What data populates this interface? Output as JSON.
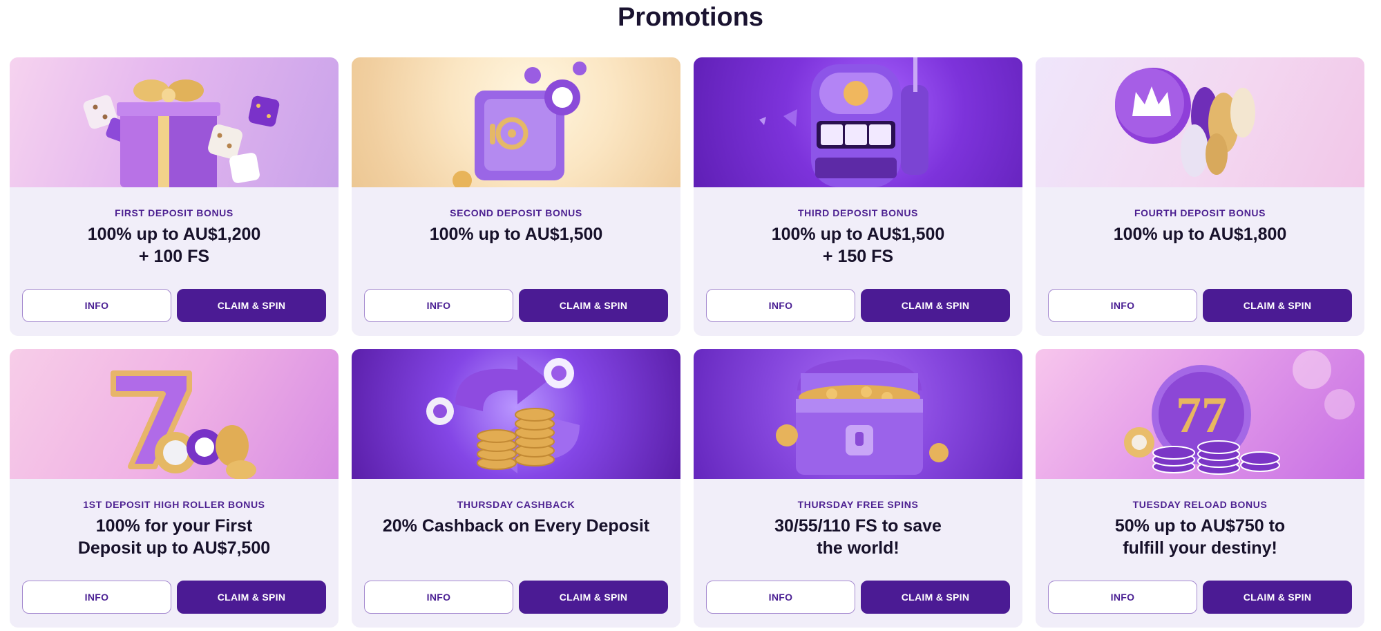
{
  "page": {
    "title": "Promotions"
  },
  "colors": {
    "brand_purple": "#4b1b94",
    "card_background": "#f1eef9",
    "eyebrow_text": "#4d2191",
    "info_border": "#a489cf"
  },
  "promotions": [
    {
      "art": "gift-box-with-dice",
      "eyebrow": "FIRST DEPOSIT BONUS",
      "headline_line1": "100% up to AU$1,200",
      "headline_line2": "+ 100 FS",
      "info_label": "INFO",
      "claim_label": "CLAIM & SPIN"
    },
    {
      "art": "purple-safe-with-chips",
      "eyebrow": "SECOND DEPOSIT BONUS",
      "headline_line1": "100% up to AU$1,500",
      "headline_line2": "",
      "info_label": "INFO",
      "claim_label": "CLAIM & SPIN"
    },
    {
      "art": "slot-machine",
      "eyebrow": "THIRD DEPOSIT BONUS",
      "headline_line1": "100% up to AU$1,500",
      "headline_line2": "+ 150 FS",
      "info_label": "INFO",
      "claim_label": "CLAIM & SPIN"
    },
    {
      "art": "crown-token-with-chips",
      "eyebrow": "FOURTH DEPOSIT BONUS",
      "headline_line1": "100% up to AU$1,800",
      "headline_line2": "",
      "info_label": "INFO",
      "claim_label": "CLAIM & SPIN"
    },
    {
      "art": "lucky-seven-with-chips",
      "eyebrow": "1ST DEPOSIT HIGH ROLLER BONUS",
      "headline_line1": "100% for your First",
      "headline_line2": "Deposit up to AU$7,500",
      "info_label": "INFO",
      "claim_label": "CLAIM & SPIN"
    },
    {
      "art": "coin-stack-cashback-arrows",
      "eyebrow": "THURSDAY CASHBACK",
      "headline_line1": "20% Cashback on Every Deposit",
      "headline_line2": "",
      "info_label": "INFO",
      "claim_label": "CLAIM & SPIN"
    },
    {
      "art": "treasure-chest-of-coins",
      "eyebrow": "THURSDAY FREE SPINS",
      "headline_line1": "30/55/110 FS to save",
      "headline_line2": "the world!",
      "info_label": "INFO",
      "claim_label": "CLAIM & SPIN"
    },
    {
      "art": "triple-seven-with-chip-stacks",
      "eyebrow": "TUESDAY RELOAD BONUS",
      "headline_line1": "50% up to AU$750 to",
      "headline_line2": "fulfill your destiny!",
      "info_label": "INFO",
      "claim_label": "CLAIM & SPIN"
    }
  ]
}
